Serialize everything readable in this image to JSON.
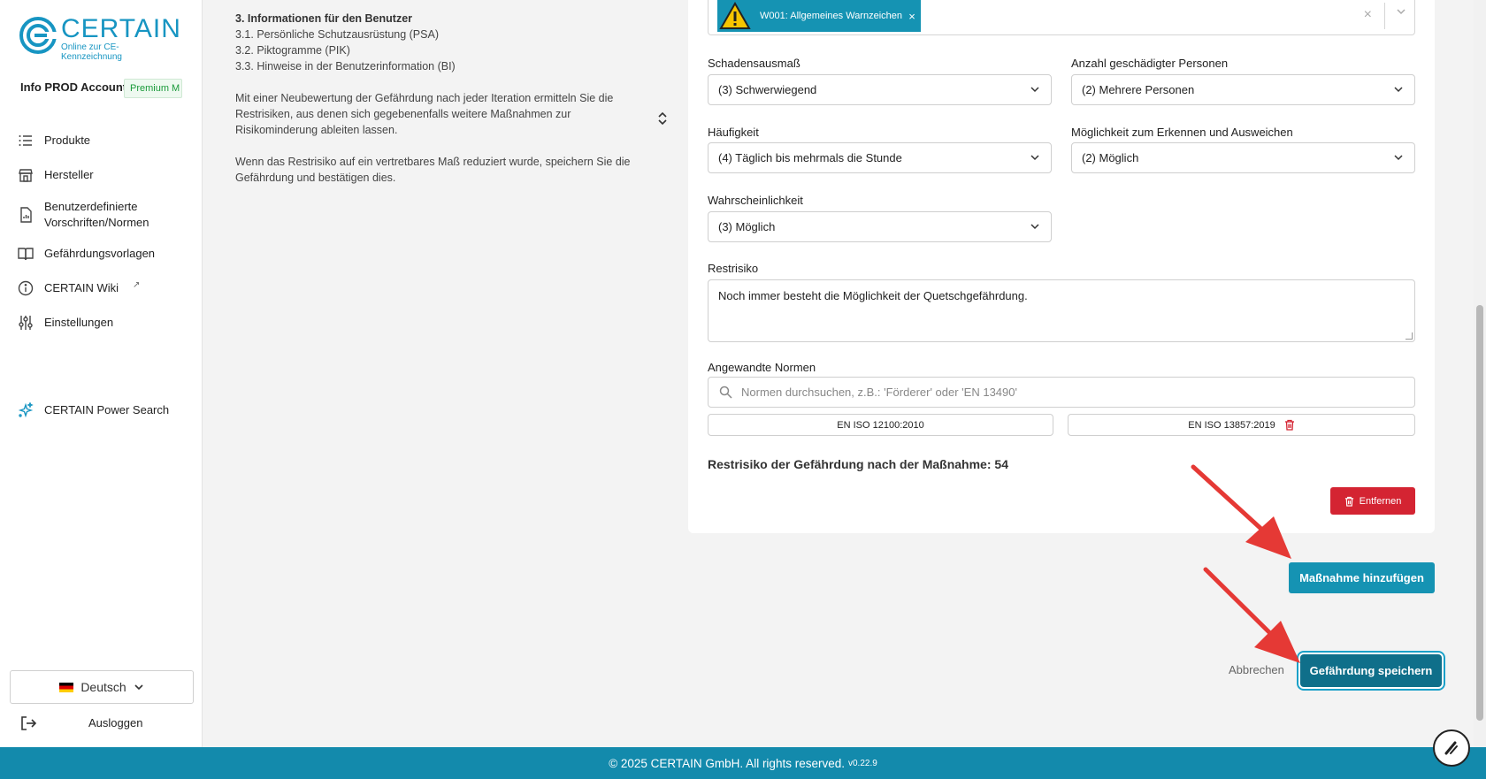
{
  "brand": {
    "name": "CERTAIN",
    "tagline": "Online zur CE-Kennzeichnung",
    "color": "#1795c2"
  },
  "account": {
    "name": "Info PROD Account",
    "plan": "Premium M"
  },
  "sidebar": {
    "items": [
      {
        "label": "Produkte",
        "icon": "list-icon"
      },
      {
        "label": "Hersteller",
        "icon": "store-icon"
      },
      {
        "label": "Benutzerdefinierte Vorschriften/Normen",
        "icon": "document-icon"
      },
      {
        "label": "Gefährdungsvorlagen",
        "icon": "book-icon"
      },
      {
        "label": "CERTAIN Wiki",
        "icon": "info-icon"
      },
      {
        "label": "Einstellungen",
        "icon": "sliders-icon"
      },
      {
        "label": "CERTAIN Power Search",
        "icon": "sparkle-icon"
      }
    ],
    "language": "Deutsch",
    "logout": "Ausloggen"
  },
  "info": {
    "heading": "3. Informationen für den Benutzer",
    "lines": [
      "3.1. Persönliche Schutzausrüstung (PSA)",
      "3.2. Piktogramme (PIK)",
      "3.3. Hinweise in der Benutzerinformation (BI)"
    ],
    "para1": "Mit einer Neubewertung der Gefährdung nach jeder Iteration ermitteln Sie die Restrisiken, aus denen sich gegebenenfalls weitere Maßnahmen zur Risikominderung ableiten lassen.",
    "para2": "Wenn das Restrisiko auf ein vertretbares Maß reduziert wurde, speichern Sie die Gefährdung und bestätigen dies."
  },
  "form": {
    "pictogram": {
      "chip": "W001: Allgemeines Warnzeichen",
      "clear": "×"
    },
    "schadensausmass": {
      "label": "Schadensausmaß",
      "value": "(3) Schwerwiegend"
    },
    "anzahl": {
      "label": "Anzahl geschädigter Personen",
      "value": "(2) Mehrere Personen"
    },
    "haeufigkeit": {
      "label": "Häufigkeit",
      "value": "(4) Täglich bis mehrmals die Stunde"
    },
    "moeglichkeit": {
      "label": "Möglichkeit zum Erkennen und Ausweichen",
      "value": "(2) Möglich"
    },
    "wahrscheinlichkeit": {
      "label": "Wahrscheinlichkeit",
      "value": "(3) Möglich"
    },
    "restrisiko": {
      "label": "Restrisiko",
      "value": "Noch immer besteht die Möglichkeit der Quetschgefährdung."
    },
    "normen": {
      "label": "Angewandte Normen",
      "placeholder": "Normen durchsuchen, z.B.: 'Förderer' oder 'EN 13490'",
      "chips": [
        "EN ISO 12100:2010",
        "EN ISO 13857:2019"
      ]
    },
    "result": {
      "label": "Restrisiko der Gefährdung nach der Maßnahme:",
      "value": "54"
    },
    "remove_label": "Entfernen"
  },
  "actions": {
    "add_measure": "Maßnahme hinzufügen",
    "cancel": "Abbrechen",
    "save": "Gefährdung speichern"
  },
  "footer": {
    "text": "© 2025 CERTAIN GmbH. All rights reserved.",
    "version": "v0.22.9"
  },
  "colors": {
    "primary": "#1593b3",
    "danger": "#d42432",
    "footer": "#138aac",
    "arrow": "#e53935"
  }
}
